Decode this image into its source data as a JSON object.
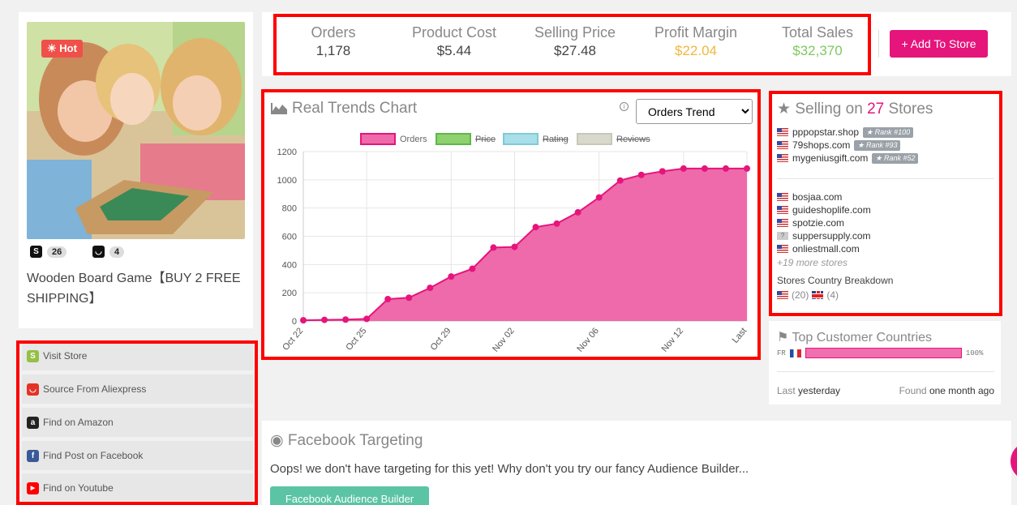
{
  "product": {
    "hot_label": "Hot",
    "shopify_count": "26",
    "aliexpress_count": "4",
    "title": "Wooden Board Game【BUY 2 FREE SHIPPING】"
  },
  "actions": [
    {
      "label": "Visit Store",
      "icon": "shopify-icon",
      "color": "#95bf47"
    },
    {
      "label": "Source From Aliexpress",
      "icon": "aliexpress-icon",
      "color": "#e43225"
    },
    {
      "label": "Find on Amazon",
      "icon": "amazon-icon",
      "color": "#222222"
    },
    {
      "label": "Find Post on Facebook",
      "icon": "facebook-icon",
      "color": "#3b5998"
    },
    {
      "label": "Find on Youtube",
      "icon": "youtube-icon",
      "color": "#ff0000"
    }
  ],
  "stats": {
    "orders_label": "Orders",
    "orders_value": "1,178",
    "cost_label": "Product Cost",
    "cost_value": "$5.44",
    "price_label": "Selling Price",
    "price_value": "$27.48",
    "margin_label": "Profit Margin",
    "margin_value": "$22.04",
    "sales_label": "Total Sales",
    "sales_value": "$32,370",
    "add_button": "+ Add To Store"
  },
  "colors": {
    "accent": "#e5157c",
    "margin": "#f0b73c",
    "sales": "#7dc95e",
    "chart_fill": "#ee6aaa",
    "chart_line": "#e5157c"
  },
  "trends": {
    "title": "Real Trends Chart",
    "select_value": "Orders Trend",
    "info_glyph": "i"
  },
  "chart_data": {
    "type": "area",
    "x": [
      "Oct 22",
      "",
      "",
      "Oct 25",
      "",
      "",
      "",
      "Oct 29",
      "",
      "",
      "Nov 02",
      "",
      "",
      "",
      "Nov 06",
      "",
      "",
      "",
      "Nov 12",
      "",
      "",
      "Last"
    ],
    "tick_labels": [
      "Oct 22",
      "Oct 25",
      "Oct 29",
      "Nov 02",
      "Nov 06",
      "Nov 12",
      "Last"
    ],
    "series": [
      {
        "name": "Orders",
        "values": [
          5,
          8,
          10,
          15,
          155,
          165,
          235,
          315,
          370,
          520,
          525,
          665,
          690,
          770,
          875,
          995,
          1035,
          1060,
          1080,
          1080,
          1080,
          1080
        ],
        "enabled": true
      },
      {
        "name": "Price",
        "enabled": false
      },
      {
        "name": "Rating",
        "enabled": false
      },
      {
        "name": "Reviews",
        "enabled": false
      }
    ],
    "legend_colors": [
      "#ee6aaa",
      "#8fd16e",
      "#a8dfe8",
      "#d8d8cc"
    ],
    "y_ticks": [
      "0",
      "200",
      "400",
      "600",
      "800",
      "1000",
      "1200"
    ],
    "ylim": [
      0,
      1200
    ],
    "grid": true,
    "legend": "top"
  },
  "stores": {
    "title_prefix": "Selling on",
    "count": "27",
    "title_suffix": "Stores",
    "ranked": [
      {
        "name": "pppopstar.shop",
        "rank": "Rank #100"
      },
      {
        "name": "79shops.com",
        "rank": "Rank #93"
      },
      {
        "name": "mygeniusgift.com",
        "rank": "Rank #52"
      }
    ],
    "others": [
      {
        "name": "bosjaa.com",
        "flag": "us"
      },
      {
        "name": "guideshoplife.com",
        "flag": "us"
      },
      {
        "name": "spotzie.com",
        "flag": "us"
      },
      {
        "name": "suppersupply.com",
        "flag": "unknown"
      },
      {
        "name": "onliestmall.com",
        "flag": "us"
      }
    ],
    "more": "+19 more stores",
    "breakdown_label": "Stores Country Breakdown",
    "breakdown_us": "(20)",
    "breakdown_uk": "(4)"
  },
  "countries": {
    "title": "Top Customer Countries",
    "code": "FR",
    "percent": "100%",
    "fraction": 1.0,
    "last_label": "Last",
    "last_value": "yesterday",
    "found_label": "Found",
    "found_value": "one month ago"
  },
  "facebook": {
    "title": "Facebook Targeting",
    "message": "Oops! we don't have targeting for this yet! Why don't you try our fancy Audience Builder...",
    "button": "Facebook Audience Builder"
  }
}
